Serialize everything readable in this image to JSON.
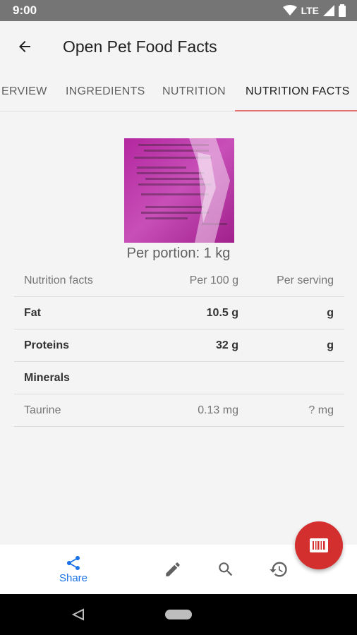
{
  "status_bar": {
    "time": "9:00",
    "network": "LTE"
  },
  "app_bar": {
    "title": "Open Pet Food Facts"
  },
  "tabs": [
    {
      "label": "ERVIEW"
    },
    {
      "label": "INGREDIENTS"
    },
    {
      "label": "NUTRITION"
    },
    {
      "label": "NUTRITION FACTS",
      "active": true
    }
  ],
  "portion": "Per portion: 1 kg",
  "nutrition_table": {
    "headers": {
      "name": "Nutrition facts",
      "per100": "Per 100 g",
      "serving": "Per serving"
    },
    "rows": [
      {
        "name": "Fat",
        "per100": "10.5 g",
        "serving": "g",
        "style": "bold"
      },
      {
        "name": "Proteins",
        "per100": "32 g",
        "serving": "g",
        "style": "bold"
      },
      {
        "name": "Minerals",
        "per100": "",
        "serving": "",
        "style": "bold"
      },
      {
        "name": "Taurine",
        "per100": "0.13 mg",
        "serving": "? mg",
        "style": "sub"
      }
    ]
  },
  "bottom_nav": {
    "share_label": "Share"
  },
  "colors": {
    "accent": "#e57373",
    "fab": "#d32f2f",
    "share": "#1a73e8"
  },
  "icons": [
    "back-arrow-icon",
    "share-icon",
    "edit-icon",
    "search-icon",
    "history-icon",
    "barcode-icon"
  ]
}
